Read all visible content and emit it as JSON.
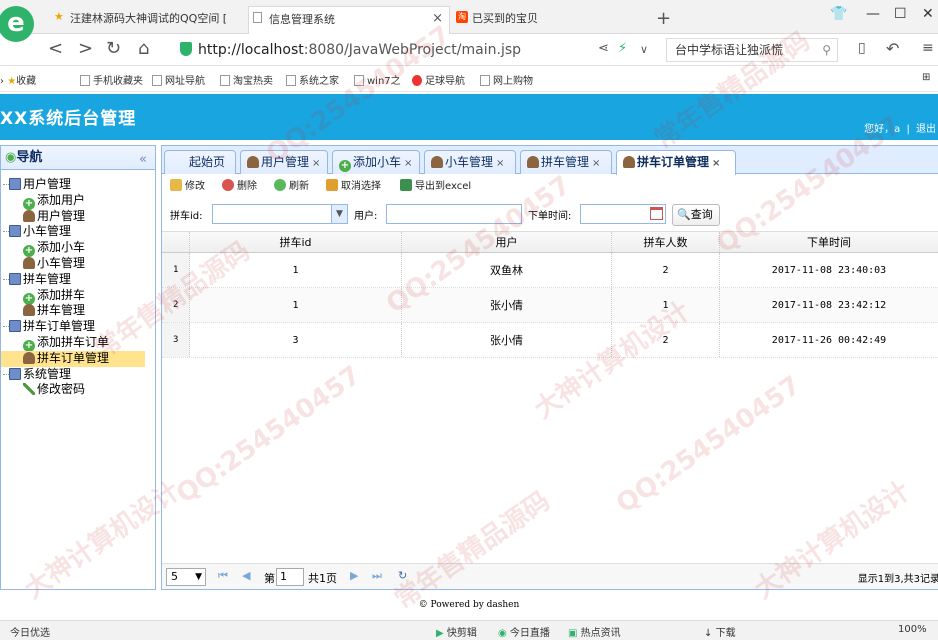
{
  "browser": {
    "tabs": [
      {
        "label": "汪建林源码大神调试的QQ空间 [",
        "icon": "star-icon"
      },
      {
        "label": "信息管理系统",
        "icon": "page-icon"
      },
      {
        "label": "已买到的宝贝",
        "icon": "taobao-icon"
      }
    ],
    "address": {
      "url_host": "http://localhost",
      "url_rest": ":8080/JavaWebProject/main.jsp"
    },
    "search_text": "台中学标语让独派慌",
    "bookmarks": [
      "收藏",
      "手机收藏夹",
      "网址导航",
      "淘宝热卖",
      "系统之家",
      "win7之",
      "足球导航",
      "网上购物"
    ]
  },
  "app": {
    "title": "XX系统后台管理",
    "user_greeting": "您好，",
    "user_name": "a",
    "logout": "退出"
  },
  "sidebar": {
    "title": "导航",
    "collapse_glyph": "«",
    "groups": [
      {
        "label": "用户管理",
        "children": [
          "添加用户",
          "用户管理"
        ]
      },
      {
        "label": "小车管理",
        "children": [
          "添加小车",
          "小车管理"
        ]
      },
      {
        "label": "拼车管理",
        "children": [
          "添加拼车",
          "拼车管理"
        ]
      },
      {
        "label": "拼车订单管理",
        "children": [
          "添加拼车订单",
          "拼车订单管理"
        ]
      },
      {
        "label": "系统管理",
        "children": [
          "修改密码"
        ]
      }
    ]
  },
  "main": {
    "tabs": [
      "起始页",
      "用户管理",
      "添加小车",
      "小车管理",
      "拼车管理",
      "拼车订单管理"
    ],
    "toolbar": {
      "edit": "修改",
      "delete": "删除",
      "refresh": "刷新",
      "cancel_select": "取消选择",
      "export": "导出到excel"
    },
    "search": {
      "carpool_id_label": "拼车id:",
      "user_label": "用户:",
      "order_time_label": "下单时间:",
      "query_button": "查询"
    },
    "grid": {
      "columns": [
        "拼车id",
        "用户",
        "拼车人数",
        "下单时间"
      ],
      "rows": [
        {
          "num": "1",
          "carpool_id": "1",
          "user": "双鱼林",
          "people": "2",
          "time": "2017-11-08 23:40:03"
        },
        {
          "num": "2",
          "carpool_id": "1",
          "user": "张小倩",
          "people": "1",
          "time": "2017-11-08 23:42:12"
        },
        {
          "num": "3",
          "carpool_id": "3",
          "user": "张小倩",
          "people": "2",
          "time": "2017-11-26 00:42:49"
        }
      ]
    },
    "pager": {
      "page_size": "5",
      "page_prefix": "第",
      "page_value": "1",
      "page_total": "共1页",
      "info": "显示1到3,共3记录"
    }
  },
  "footer": "© Powered by dashen",
  "statusbar": {
    "left": "今日优选",
    "items": [
      "快剪辑",
      "今日直播",
      "热点资讯",
      "下载",
      "100%"
    ]
  },
  "watermark": {
    "text_qq": "QQ:254540457",
    "text_a": "大神计算机设计",
    "text_b": "常年售精品源码"
  }
}
